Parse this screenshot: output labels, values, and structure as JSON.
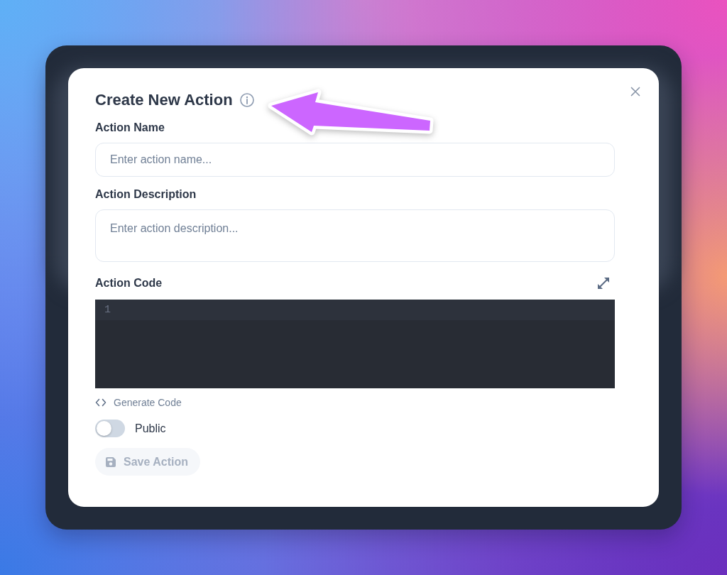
{
  "dialog": {
    "title": "Create New Action",
    "fields": [
      {
        "kind": "text",
        "label": "Action Name",
        "placeholder": "Enter action name..."
      },
      {
        "kind": "textarea",
        "label": "Action Description",
        "placeholder": "Enter action description..."
      },
      {
        "kind": "code",
        "label": "Action Code",
        "line_numbers": [
          "1"
        ]
      }
    ],
    "generate_link": {
      "label": "Generate Code"
    },
    "toggle": {
      "label": "Public",
      "on": false
    },
    "save_button": {
      "label": "Save Action",
      "disabled": true
    }
  }
}
